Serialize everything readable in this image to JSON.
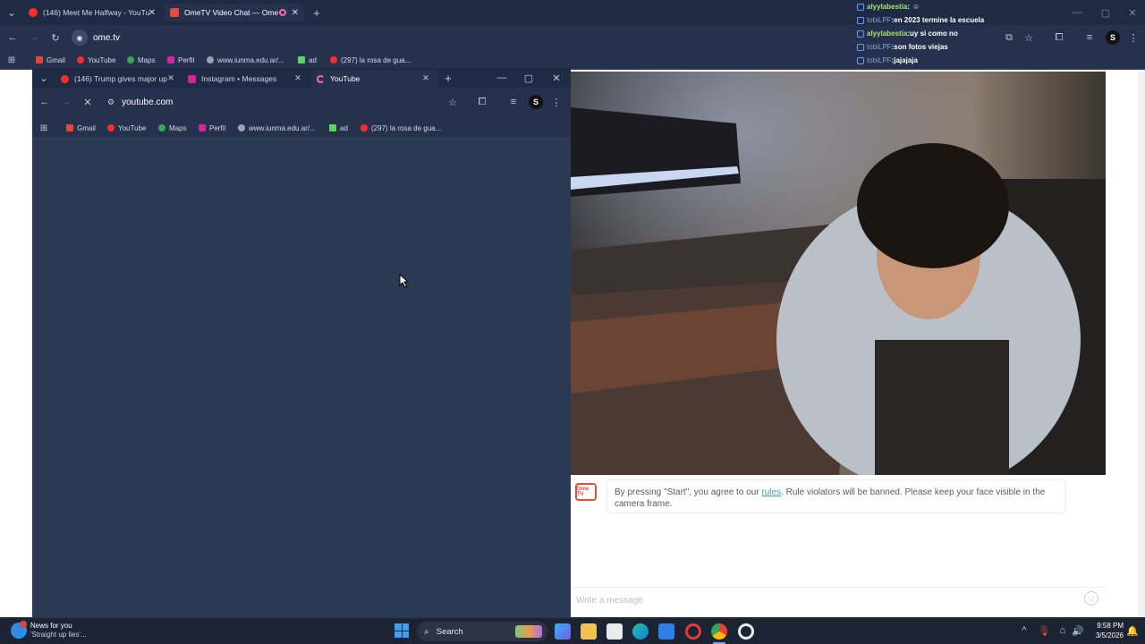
{
  "outer": {
    "tabs": [
      {
        "label": "(146) Meet Me Halfway - YouTu"
      },
      {
        "label": "OmeTV Video Chat — Ome"
      }
    ],
    "address": "ome.tv",
    "bookmarks": [
      "Gmail",
      "YouTube",
      "Maps",
      "Perfil",
      "www.iunma.edu.ar/...",
      "ad",
      "(297) la rosa de gua..."
    ]
  },
  "chat": [
    {
      "user": "alyylabestia",
      "sep": " : ",
      "text": "",
      "userClass": "u1",
      "emote": true
    },
    {
      "user": "tobiLPF",
      "sep": " : ",
      "text": "en 2023 termine la escuela",
      "userClass": "u2"
    },
    {
      "user": "alyylabestia",
      "sep": " : ",
      "text": "uy si como no",
      "userClass": "u1"
    },
    {
      "user": "tobiLPF",
      "sep": " : ",
      "text": "son fotos viejas",
      "userClass": "u2"
    },
    {
      "user": "tobiLPF",
      "sep": " : ",
      "text": "jajajaja",
      "userClass": "u2"
    }
  ],
  "inner": {
    "tabs": [
      {
        "label": "(146) Trump gives major up"
      },
      {
        "label": "Instagram • Messages"
      },
      {
        "label": "YouTube"
      }
    ],
    "address": "youtube.com",
    "bookmarks": [
      "Gmail",
      "YouTube",
      "Maps",
      "Perfil",
      "www.iunma.edu.ar/...",
      "ad",
      "(297) la rosa de gua..."
    ]
  },
  "ome": {
    "logo_text": "Ome TV",
    "notice_pre": "By pressing \"Start\", you agree to our ",
    "notice_link": "rules",
    "notice_post": ". Rule violators will be banned. Please keep your face visible in the camera frame.",
    "message_placeholder": "Write a message"
  },
  "taskbar": {
    "news_title": "News for you",
    "news_sub": "'Straight up lies'...",
    "search_label": "Search",
    "time": "9:58 PM",
    "date": "3/5/2026"
  },
  "colors": {
    "chrome_dark": "#1f2b45",
    "chrome_toolbar": "#26324d",
    "inner_content": "#2a3a55",
    "ome_accent": "#e04d3a",
    "link": "#39a0d8"
  }
}
